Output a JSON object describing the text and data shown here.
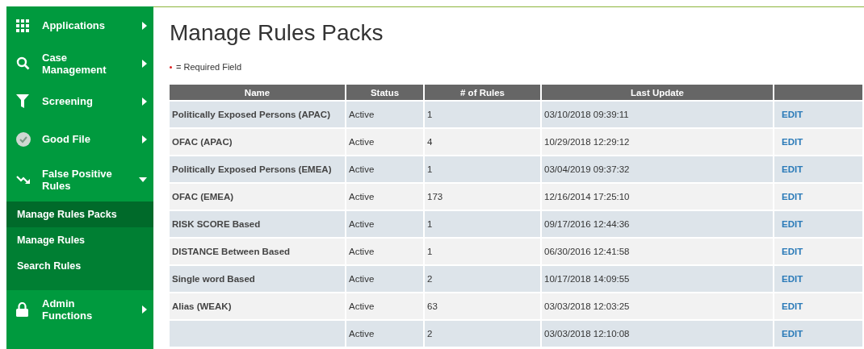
{
  "sidebar": {
    "items": [
      {
        "label": "Applications",
        "expanded": false
      },
      {
        "label": "Case Management",
        "expanded": false
      },
      {
        "label": "Screening",
        "expanded": false
      },
      {
        "label": "Good File",
        "expanded": false
      },
      {
        "label": "False Positive Rules",
        "expanded": true,
        "children": [
          {
            "label": "Manage Rules Packs",
            "selected": true
          },
          {
            "label": "Manage Rules",
            "selected": false
          },
          {
            "label": "Search Rules",
            "selected": false
          }
        ]
      },
      {
        "label": "Admin Functions",
        "expanded": false
      }
    ]
  },
  "page": {
    "title": "Manage Rules Packs",
    "required_note": "= Required Field"
  },
  "table": {
    "columns": [
      "Name",
      "Status",
      "# of Rules",
      "Last Update"
    ],
    "rows": [
      {
        "name": "Politically Exposed Persons (APAC)",
        "status": "Active",
        "rules": "1",
        "last_update": "03/10/2018 09:39:11",
        "action": "EDIT"
      },
      {
        "name": "OFAC (APAC)",
        "status": "Active",
        "rules": "4",
        "last_update": "10/29/2018 12:29:12",
        "action": "EDIT"
      },
      {
        "name": "Politically Exposed Persons (EMEA)",
        "status": "Active",
        "rules": "1",
        "last_update": "03/04/2019 09:37:32",
        "action": "EDIT"
      },
      {
        "name": "OFAC (EMEA)",
        "status": "Active",
        "rules": "173",
        "last_update": "12/16/2014 17:25:10",
        "action": "EDIT"
      },
      {
        "name": "RISK SCORE Based",
        "status": "Active",
        "rules": "1",
        "last_update": "09/17/2016 12:44:36",
        "action": "EDIT"
      },
      {
        "name": "DISTANCE  Between Based",
        "status": "Active",
        "rules": "1",
        "last_update": "06/30/2016 12:41:58",
        "action": "EDIT"
      },
      {
        "name": "Single word Based",
        "status": "Active",
        "rules": "2",
        "last_update": "10/17/2018 14:09:55",
        "action": "EDIT"
      },
      {
        "name": "Alias (WEAK)",
        "status": "Active",
        "rules": "63",
        "last_update": "03/03/2018 12:03:25",
        "action": "EDIT"
      },
      {
        "status": "Active",
        "rules": "2",
        "last_update": "03/03/2018 12:10:08",
        "action": "EDIT"
      }
    ]
  }
}
